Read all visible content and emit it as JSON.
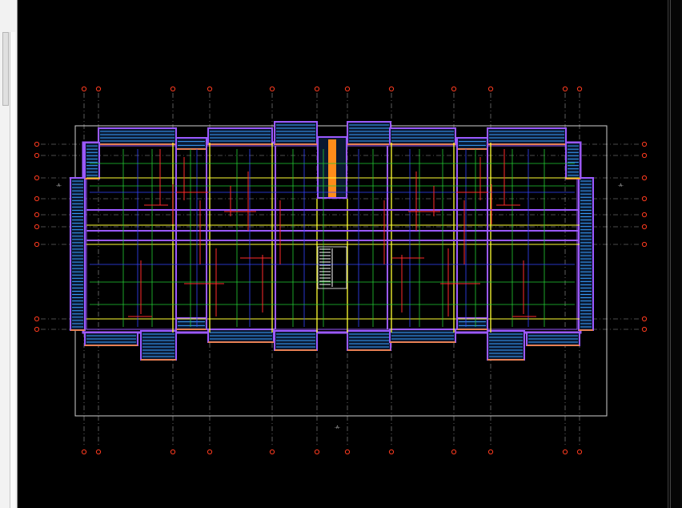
{
  "viewer": {
    "title": "",
    "background": "#000000",
    "panel_color": "#f2f2f2"
  },
  "drawing": {
    "grid_bubble_color": "#ff3b1f",
    "grid_line_color": "#9a9a9a",
    "wall_color": "#9b59ff",
    "beam_color": "#ffff33",
    "pipe_green_color": "#22cc33",
    "pipe_blue_color": "#3344ff",
    "red_detail_color": "#ff2a2a",
    "balcony_fill_color": "#3aa0ff",
    "trim_color": "#ff8c1a",
    "annotations": [
      "-A-",
      "-A-",
      "-A-"
    ]
  },
  "icons": {
    "left_panel": "panel-edge-icon",
    "scrollbar": "scrollbar-icon"
  }
}
